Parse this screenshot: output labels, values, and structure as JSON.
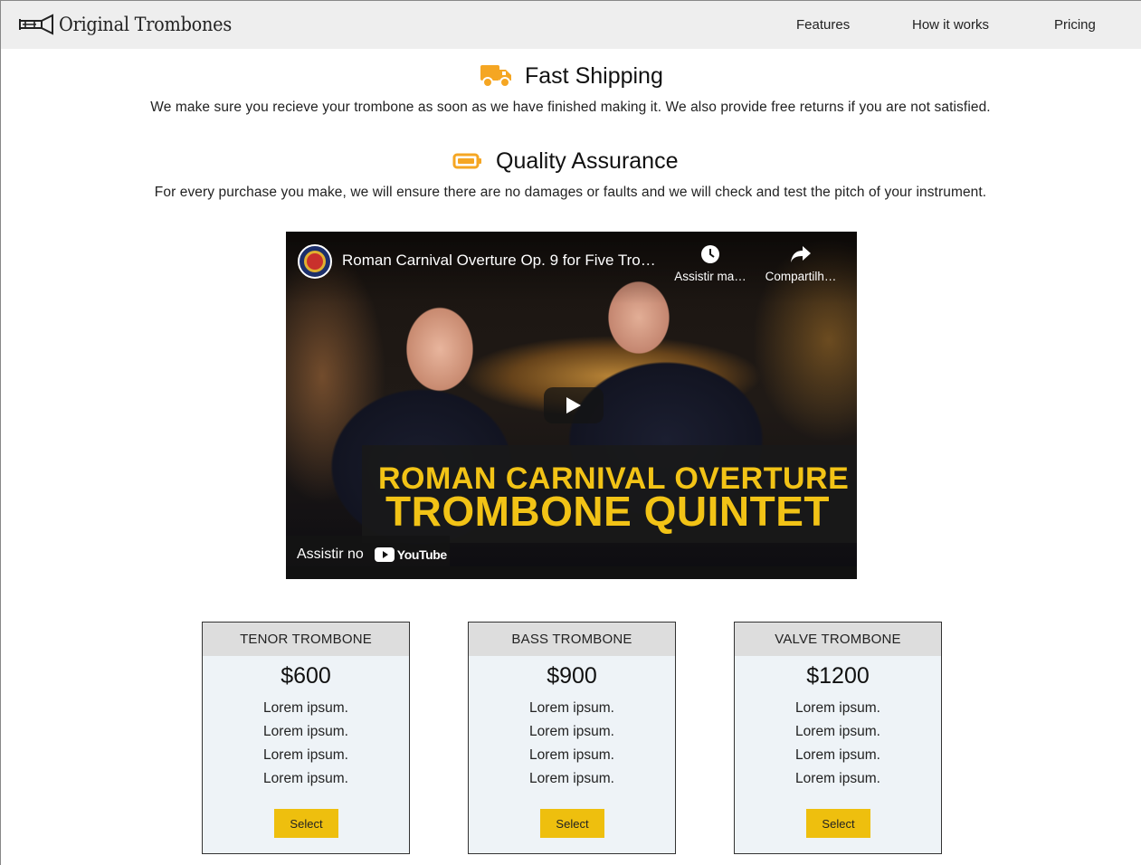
{
  "header": {
    "brand": "Original Trombones",
    "nav": [
      "Features",
      "How it works",
      "Pricing"
    ]
  },
  "features": [
    {
      "icon": "truck-icon",
      "title": "Fast Shipping",
      "description": "We make sure you recieve your trombone as soon as we have finished making it. We also provide free returns if you are not satisfied."
    },
    {
      "icon": "battery-icon",
      "title": "Quality Assurance",
      "description": "For every purchase you make, we will ensure there are no damages or faults and we will check and test the pitch of your instrument."
    }
  ],
  "video": {
    "title": "Roman Carnival Overture Op. 9 for Five Tro…",
    "watch_later": "Assistir ma…",
    "share": "Compartilh…",
    "banner_line1": "ROMAN CARNIVAL OVERTURE",
    "banner_line2": "TROMBONE QUINTET",
    "watch_on": "Assistir no",
    "platform": "YouTube"
  },
  "pricing": [
    {
      "name": "TENOR TROMBONE",
      "price": "$600",
      "features": [
        "Lorem ipsum.",
        "Lorem ipsum.",
        "Lorem ipsum.",
        "Lorem ipsum."
      ],
      "button": "Select"
    },
    {
      "name": "BASS TROMBONE",
      "price": "$900",
      "features": [
        "Lorem ipsum.",
        "Lorem ipsum.",
        "Lorem ipsum.",
        "Lorem ipsum."
      ],
      "button": "Select"
    },
    {
      "name": "VALVE TROMBONE",
      "price": "$1200",
      "features": [
        "Lorem ipsum.",
        "Lorem ipsum.",
        "Lorem ipsum.",
        "Lorem ipsum."
      ],
      "button": "Select"
    }
  ],
  "colors": {
    "accent": "#eebf0e",
    "icon_orange": "#f5a623",
    "header_bg": "#eeeeee",
    "card_bg": "#eef3f7",
    "banner_text": "#f2c316"
  }
}
